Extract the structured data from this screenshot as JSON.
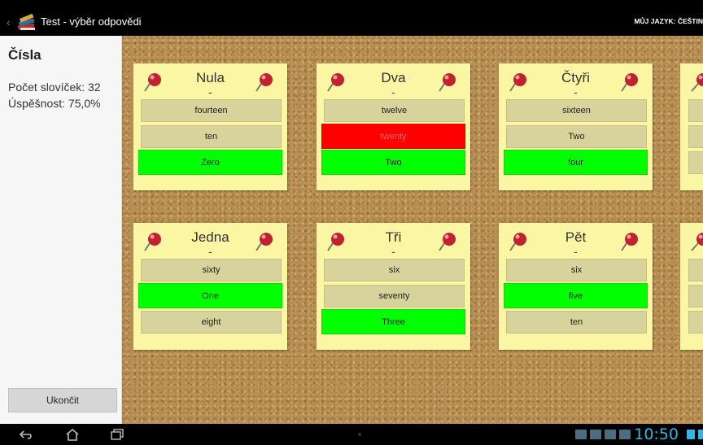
{
  "app": {
    "title": "Test - výběr odpovědi",
    "language_label": "MŮJ JAZYK: ČEŠTIN"
  },
  "sidebar": {
    "title": "Čísla",
    "word_count": "Počet slovíček: 32",
    "success": "Úspěšnost: 75,0%",
    "quit_label": "Ukončit"
  },
  "cards": [
    {
      "word": "Nula",
      "answer": "-",
      "options": [
        {
          "label": "fourteen",
          "state": "neutral"
        },
        {
          "label": "ten",
          "state": "neutral"
        },
        {
          "label": "Zero",
          "state": "correct"
        }
      ]
    },
    {
      "word": "Dva",
      "answer": "-",
      "options": [
        {
          "label": "twelve",
          "state": "neutral"
        },
        {
          "label": "twenty",
          "state": "wrong"
        },
        {
          "label": "Two",
          "state": "correct"
        }
      ]
    },
    {
      "word": "Čtyři",
      "answer": "-",
      "options": [
        {
          "label": "sixteen",
          "state": "neutral"
        },
        {
          "label": "Two",
          "state": "neutral"
        },
        {
          "label": "four",
          "state": "correct"
        }
      ]
    },
    {
      "word": "Jedna",
      "answer": "-",
      "options": [
        {
          "label": "sixty",
          "state": "neutral"
        },
        {
          "label": "One",
          "state": "correct"
        },
        {
          "label": "eight",
          "state": "neutral"
        }
      ]
    },
    {
      "word": "Tři",
      "answer": "-",
      "options": [
        {
          "label": "six",
          "state": "neutral"
        },
        {
          "label": "seventy",
          "state": "neutral"
        },
        {
          "label": "Three",
          "state": "correct"
        }
      ]
    },
    {
      "word": "Pět",
      "answer": "-",
      "options": [
        {
          "label": "six",
          "state": "neutral"
        },
        {
          "label": "five",
          "state": "correct"
        },
        {
          "label": "ten",
          "state": "neutral"
        }
      ]
    }
  ],
  "status_bar": {
    "clock": "10:50"
  },
  "icons": {
    "back": "chevron-left-icon",
    "app": "books-icon",
    "pin": "pushpin-icon",
    "nav_back": "back-arrow-icon",
    "nav_home": "home-icon",
    "nav_recent": "recent-apps-icon"
  },
  "colors": {
    "card": "#fbf6a3",
    "option": "#d8d29c",
    "correct": "#00ff00",
    "wrong": "#ff0000",
    "cork": "#b58d52",
    "clock": "#33b5e5"
  }
}
